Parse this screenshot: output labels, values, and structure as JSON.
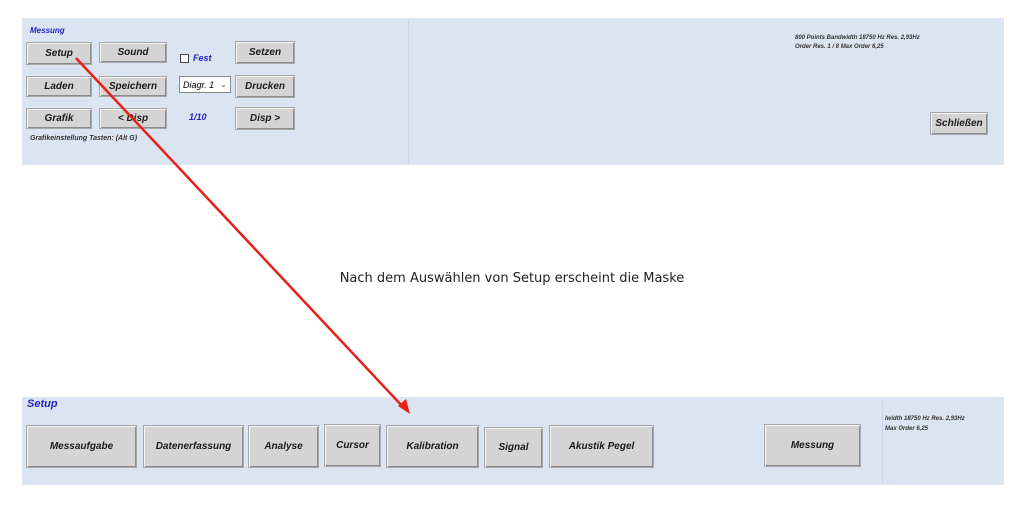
{
  "top": {
    "title": "Messung",
    "buttons": {
      "setup": "Setup",
      "sound": "Sound",
      "setzen": "Setzen",
      "laden": "Laden",
      "speichern": "Speichern",
      "drucken": "Drucken",
      "grafik": "Grafik",
      "disp_prev": "< Disp",
      "disp_next": "Disp >",
      "schliessen": "Schließen"
    },
    "fest_label": "Fest",
    "fest_checked": false,
    "diagram_select": "Diagr. 1",
    "page_counter": "1/10",
    "hint": "Grafikeinstellung Tasten: (Alt G)",
    "info_line1": "800 Points  Bandwidth 18750 Hz  Res. 2,93Hz",
    "info_line2": "Order Res.  1 / 8 Max Order 6,25"
  },
  "caption": "Nach dem Auswählen von Setup erscheint die Maske",
  "bottom": {
    "title": "Setup",
    "tabs": {
      "messaufgabe": "Messaufgabe",
      "datenerfassung": "Datenerfassung",
      "analyse": "Analyse",
      "cursor": "Cursor",
      "kalibration": "Kalibration",
      "signal": "Signal",
      "akustik": "Akustik Pegel",
      "messung": "Messung"
    },
    "info_line1": "lwidth 18750 Hz  Res. 2,93Hz",
    "info_line2": "Max Order 6,25"
  },
  "colors": {
    "panel": "#dbe5f1",
    "accent_blue": "#1f1fbf",
    "arrow": "#e8201a"
  }
}
